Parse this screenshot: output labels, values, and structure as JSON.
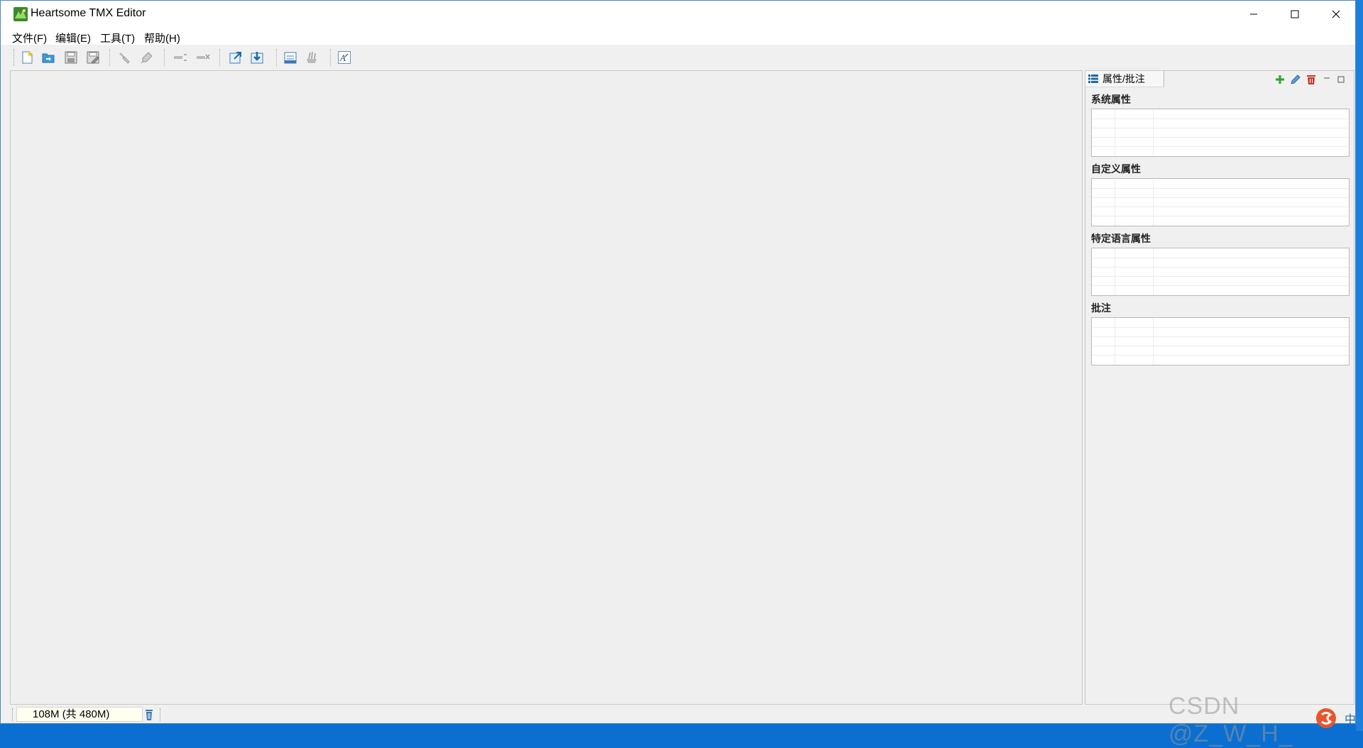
{
  "window": {
    "title": "Heartsome TMX Editor"
  },
  "menu": [
    {
      "label": "文件(F)"
    },
    {
      "label": "编辑(E)"
    },
    {
      "label": "工具(T)"
    },
    {
      "label": "帮助(H)"
    }
  ],
  "toolbar": {
    "icons": [
      "new-file-icon",
      "open-file-icon",
      "save-icon",
      "save-as-icon",
      "find-icon",
      "replace-icon",
      "add-row-icon",
      "delete-row-icon",
      "import-icon",
      "export-icon",
      "filter-icon",
      "clean-icon",
      "font-icon"
    ]
  },
  "side_panel": {
    "tab_label": "属性/批注",
    "sections": [
      {
        "label": "系统属性"
      },
      {
        "label": "自定义属性"
      },
      {
        "label": "特定语言属性"
      },
      {
        "label": "批注"
      }
    ]
  },
  "status": {
    "memory": "108M  (共 480M)"
  },
  "watermark": "CSDN @Z_W_H_",
  "ime": {
    "label": "中"
  },
  "colors": {
    "accent": "#0a6fd1",
    "add": "#2aa52a",
    "delete": "#c0392b"
  }
}
